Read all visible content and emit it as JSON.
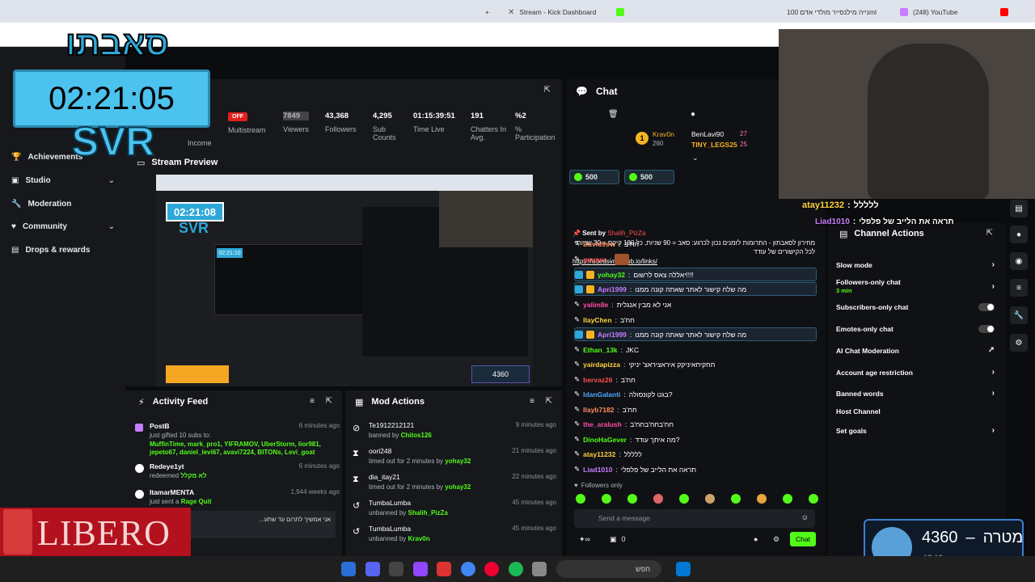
{
  "browser": {
    "tabs": [
      {
        "label": "Stream - Kick Dashboard",
        "active": true
      },
      {
        "label": "נייה מילנסייר מולדי אדם 100ml"
      },
      {
        "label": "(248) YouTube"
      }
    ],
    "new_tab": "+"
  },
  "overlay": {
    "timer": "02:21:05",
    "brand": "SVR",
    "logo_text": "סאבתו"
  },
  "sidebar": {
    "income_label": "Income",
    "items": [
      {
        "label": "Achievements",
        "chev": false
      },
      {
        "label": "Studio",
        "chev": true
      },
      {
        "label": "Moderation",
        "chev": false
      },
      {
        "label": "Community",
        "chev": true
      },
      {
        "label": "Drops & rewards",
        "chev": false
      }
    ]
  },
  "stats": {
    "multistream_badge": "OFF",
    "multistream_label": "Multistream",
    "viewers_value": "7849",
    "viewers_label": "Viewers",
    "followers_value": "43,368",
    "followers_label": "Followers",
    "subs_value": "4,295",
    "subs_label": "Sub Counts",
    "time_value": "01:15:39:51",
    "time_label": "Time Live",
    "chatters_value": "191",
    "chatters_label": "Chatters In Avg.",
    "participation_value": "%2",
    "participation_label": "% Participation"
  },
  "preview": {
    "title": "Stream Preview",
    "inner_timer": "02:21:08",
    "inner_brand": "SVR",
    "inner_timer_small": "02:21:10",
    "inner_counter": "4360"
  },
  "activity_feed": {
    "title": "Activity Feed",
    "items": [
      {
        "name": "PostB",
        "desc": "just gifted 10 subs to:",
        "gift_list": "MuffinTime, mark_pro1, YIFRAMOV, UberStorm, lior981, jepeto67, daniel_levi67, avavi7224, BITONs, Levi_goat",
        "time": "6 minutes ago"
      },
      {
        "name": "Redeye1yt",
        "desc": "redeemed",
        "reward": "לא מקלל",
        "time": "6 minutes ago"
      },
      {
        "name": "ItamarMENTA",
        "desc": "just sent a",
        "reward": "Rage Quit",
        "time": "1,944 weeks ago"
      }
    ],
    "quote": "אני אמשיך לתרום עד שתע..."
  },
  "mod_actions": {
    "title": "Mod Actions",
    "items": [
      {
        "name": "Te1912212121",
        "desc": "banned by",
        "by": "Chitos126",
        "time": "9 minutes ago",
        "icon": "ban"
      },
      {
        "name": "oori248",
        "desc": "timed out for 2 minutes by",
        "by": "yohay32",
        "time": "21 minutes ago",
        "icon": "hourglass"
      },
      {
        "name": "dia_itay21",
        "desc": "timed out for 2 minutes by",
        "by": "yohay32",
        "time": "22 minutes ago",
        "icon": "hourglass"
      },
      {
        "name": "TumbaLumba",
        "desc": "unbanned by",
        "by": "Shalih_PizZa",
        "time": "45 minutes ago",
        "icon": "undo"
      },
      {
        "name": "TumbaLumba",
        "desc": "unbanned by",
        "by": "Krav0n",
        "time": "45 minutes ago",
        "icon": "undo"
      }
    ]
  },
  "chat": {
    "title": "Chat",
    "leaders": [
      {
        "rank": "1",
        "name": "Krav0n",
        "score": "260"
      },
      {
        "name": "BenLavi90",
        "score": "27"
      },
      {
        "name": "TINY_LEGS25",
        "score": "25"
      }
    ],
    "goals": [
      "500",
      "500"
    ],
    "pinned_sender_label": "Sent by",
    "pinned_sender": "Shalih_PizZa",
    "pinned_text": "מחירון לסאבתון - התרומות לזמנים נכון לכרגע: סאב = 90 שניות, כל 100 קיקס = 30 שניות. לכל הקישורים של עודד",
    "pinned_link": "https://odedsvr.github.io/links/",
    "messages": [
      {
        "user": "David9svr",
        "text": "חח'ב",
        "color": "#ff8c5a"
      },
      {
        "user": "guypor",
        "text": "",
        "color": "#ff4d4d"
      },
      {
        "user": "yohay32",
        "text": "יאללה צאס לרשום!!!!",
        "color": "#53fc18",
        "hl": true
      },
      {
        "user": "Apri1999",
        "text": "מה שלח קישור לאתר שאתה קונה ממנו",
        "color": "#c77dff",
        "hl": true
      },
      {
        "user": "yalim8e",
        "text": "אני לא מבין אנגלית",
        "color": "#ff4da6"
      },
      {
        "user": "IlayChen",
        "text": "חח'ב",
        "color": "#ffd23f"
      },
      {
        "user": "Apri1999",
        "text": "מה שלח קישור לאתר שאתה קונה ממנו",
        "color": "#c77dff",
        "hl": true
      },
      {
        "user": "Ethan_13k",
        "text": "JKC",
        "color": "#53fc18"
      },
      {
        "user": "yairdapizza",
        "text": "חחקיחאיניקק איראציראצ' יניקי",
        "color": "#ffd23f"
      },
      {
        "user": "bervaz26",
        "text": "חח'ב",
        "color": "#ff4d4d"
      },
      {
        "user": "IdanGalanti",
        "text": "בגט לקונסולה?",
        "color": "#4da6ff"
      },
      {
        "user": "Ilayb7182",
        "text": "חח'ב",
        "color": "#ff8c5a"
      },
      {
        "user": "the_aralush",
        "text": "חח'בחח'בחח'ב",
        "color": "#ff4da6"
      },
      {
        "user": "DinoHaGever",
        "text": "מה איתך עודד?",
        "color": "#53fc18"
      },
      {
        "user": "atay11232",
        "text": "ללללל",
        "color": "#ffd23f"
      },
      {
        "user": "Liad1010",
        "text": "תראה את הלייב של פלפלי",
        "color": "#c77dff"
      }
    ],
    "followers_only": "Followers only",
    "input_placeholder": "Send a message",
    "points": "0",
    "send_label": "Chat"
  },
  "channel_actions": {
    "title": "Channel Actions",
    "items": [
      {
        "label": "Slow mode",
        "type": "chev"
      },
      {
        "label": "Followers-only chat",
        "sub": "3 min",
        "type": "chev"
      },
      {
        "label": "Subscribers-only chat",
        "type": "toggle"
      },
      {
        "label": "Emotes-only chat",
        "type": "toggle"
      },
      {
        "label": "AI Chat Moderation",
        "type": "ext"
      },
      {
        "label": "Account age restriction",
        "type": "chev"
      },
      {
        "label": "Banned words",
        "type": "chev"
      },
      {
        "label": "Host Channel",
        "type": "none"
      },
      {
        "label": "Set goals",
        "type": "chev"
      }
    ]
  },
  "overlay_chat": {
    "line1_user": "atay11232",
    "line1_text": "ללללל",
    "line2_user": "Liad1010",
    "line2_text": "תראה את הלייב של פלפלי"
  },
  "goal_widget": {
    "value": "4360",
    "dash": "–",
    "label": "מטרה",
    "sub": "4349"
  },
  "sponsor": {
    "text": "LIBERO"
  },
  "taskbar": {
    "search": "חפש"
  }
}
